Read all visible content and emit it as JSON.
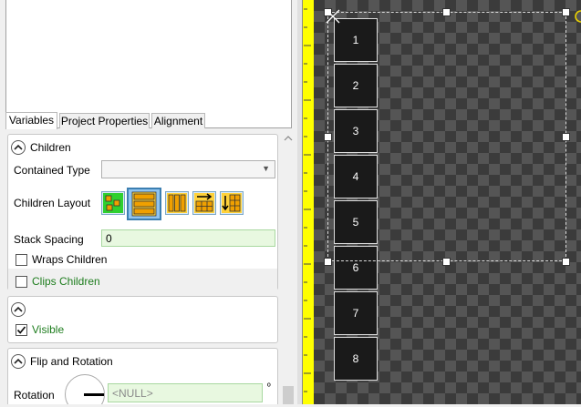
{
  "tabs": [
    {
      "label": "Variables",
      "active": true
    },
    {
      "label": "Project Properties",
      "active": false
    },
    {
      "label": "Alignment",
      "active": false
    }
  ],
  "children_section": {
    "title": "Children",
    "contained_type_label": "Contained Type",
    "contained_type_value": "",
    "children_layout_label": "Children Layout",
    "layout_options": [
      "free",
      "top-to-bottom-stack",
      "left-to-right-stack",
      "auto-grid-horizontal",
      "auto-grid-vertical"
    ],
    "selected_layout": "top-to-bottom-stack",
    "stack_spacing_label": "Stack Spacing",
    "stack_spacing_value": "0",
    "wraps_children_label": "Wraps Children",
    "wraps_children_checked": false,
    "clips_children_label": "Clips Children",
    "clips_children_checked": false
  },
  "visibility_section": {
    "visible_label": "Visible",
    "visible_checked": true
  },
  "flip_section": {
    "title": "Flip and Rotation",
    "rotation_label": "Rotation",
    "rotation_value": "<NULL>",
    "degree_symbol": "º"
  },
  "canvas": {
    "tiles": [
      "1",
      "2",
      "3",
      "4",
      "5",
      "6",
      "7",
      "8"
    ]
  },
  "colors": {
    "green_text": "#1e7d1e",
    "field_bg": "#e8f8e0",
    "ruler": "#ffff00"
  }
}
